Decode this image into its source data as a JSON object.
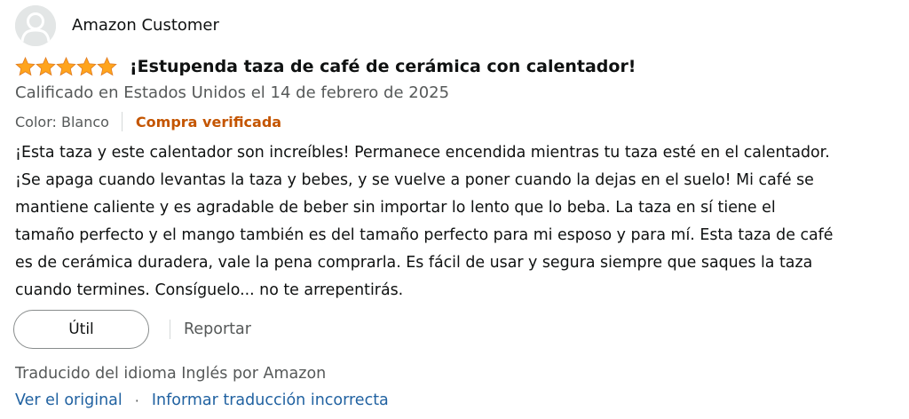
{
  "profile": {
    "name": "Amazon Customer"
  },
  "rating": {
    "stars": 5,
    "max": 5,
    "color": "#ffa41c"
  },
  "review": {
    "title": "¡Estupenda taza de café de cerámica con calentador!",
    "date": "Calificado en Estados Unidos el 14 de febrero de 2025",
    "variant": "Color: Blanco",
    "verified_label": "Compra verificada",
    "body_lines": [
      "¡Esta taza y este calentador son increíbles! Permanece encendida mientras tu taza esté en el calentador.",
      "¡Se apaga cuando levantas la taza y bebes, y se vuelve a poner cuando la dejas en el suelo! Mi café se",
      "mantiene caliente y es agradable de beber sin importar lo lento que lo beba. La taza en sí tiene el",
      "tamaño perfecto y el mango también es del tamaño perfecto para mi esposo y para mí. Esta taza de café",
      "es de cerámica duradera, vale la pena comprarla. Es fácil de usar y segura siempre que saques la taza",
      "cuando termines. Consíguelo... no te arrepentirás."
    ]
  },
  "actions": {
    "helpful_label": "Útil",
    "report_label": "Reportar"
  },
  "translation": {
    "notice": "Traducido del idioma Inglés por Amazon",
    "view_original_label": "Ver el original",
    "separator": "·",
    "report_translation_label": "Informar traducción incorrecta"
  },
  "colors": {
    "link": "#2162a1",
    "verified": "#c45500",
    "secondary_text": "#565959",
    "star": "#ffa41c"
  },
  "icons": {
    "avatar": "default-user-avatar-icon",
    "star": "star-filled-icon"
  }
}
